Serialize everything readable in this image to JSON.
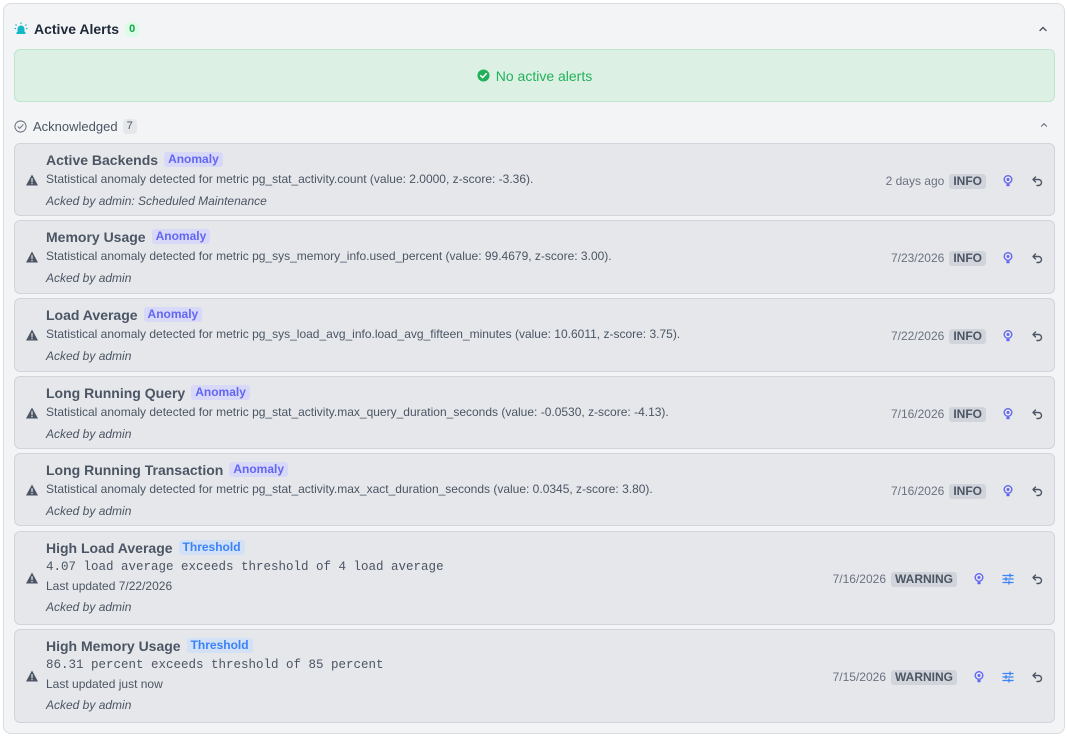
{
  "active": {
    "title": "Active Alerts",
    "count": "0",
    "empty_message": "No active alerts"
  },
  "acknowledged": {
    "label": "Acknowledged",
    "count": "7",
    "items": [
      {
        "name": "Active Backends",
        "tag": "Anomaly",
        "tag_type": "anomaly",
        "description": "Statistical anomaly detected for metric pg_stat_activity.count (value: 2.0000, z-score: -3.36).",
        "updated": "",
        "acked": "Acked by admin: Scheduled Maintenance",
        "when": "2 days ago",
        "severity": "INFO",
        "icons": [
          "lightbulb-icon",
          "undo-icon"
        ]
      },
      {
        "name": "Memory Usage",
        "tag": "Anomaly",
        "tag_type": "anomaly",
        "description": "Statistical anomaly detected for metric pg_sys_memory_info.used_percent (value: 99.4679, z-score: 3.00).",
        "updated": "",
        "acked": "Acked by admin",
        "when": "7/23/2026",
        "severity": "INFO",
        "icons": [
          "lightbulb-icon",
          "undo-icon"
        ]
      },
      {
        "name": "Load Average",
        "tag": "Anomaly",
        "tag_type": "anomaly",
        "description": "Statistical anomaly detected for metric pg_sys_load_avg_info.load_avg_fifteen_minutes (value: 10.6011, z-score: 3.75).",
        "updated": "",
        "acked": "Acked by admin",
        "when": "7/22/2026",
        "severity": "INFO",
        "icons": [
          "lightbulb-icon",
          "undo-icon"
        ]
      },
      {
        "name": "Long Running Query",
        "tag": "Anomaly",
        "tag_type": "anomaly",
        "description": "Statistical anomaly detected for metric pg_stat_activity.max_query_duration_seconds (value: -0.0530, z-score: -4.13).",
        "updated": "",
        "acked": "Acked by admin",
        "when": "7/16/2026",
        "severity": "INFO",
        "icons": [
          "lightbulb-icon",
          "undo-icon"
        ]
      },
      {
        "name": "Long Running Transaction",
        "tag": "Anomaly",
        "tag_type": "anomaly",
        "description": "Statistical anomaly detected for metric pg_stat_activity.max_xact_duration_seconds (value: 0.0345, z-score: 3.80).",
        "updated": "",
        "acked": "Acked by admin",
        "when": "7/16/2026",
        "severity": "INFO",
        "icons": [
          "lightbulb-icon",
          "undo-icon"
        ]
      },
      {
        "name": "High Load Average",
        "tag": "Threshold",
        "tag_type": "threshold",
        "description": "4.07 load average exceeds threshold of 4 load average",
        "updated": "Last updated 7/22/2026",
        "acked": "Acked by admin",
        "when": "7/16/2026",
        "severity": "WARNING",
        "icons": [
          "lightbulb-icon",
          "sliders-icon",
          "undo-icon"
        ]
      },
      {
        "name": "High Memory Usage",
        "tag": "Threshold",
        "tag_type": "threshold",
        "description": "86.31 percent exceeds threshold of 85 percent",
        "updated": "Last updated just now",
        "acked": "Acked by admin",
        "when": "7/15/2026",
        "severity": "WARNING",
        "icons": [
          "lightbulb-icon",
          "sliders-icon",
          "undo-icon"
        ]
      }
    ]
  },
  "colors": {
    "success": "#22b15a",
    "anomaly": "#6366f1",
    "threshold": "#3b82f6",
    "accent_teal": "#14b8c8"
  }
}
